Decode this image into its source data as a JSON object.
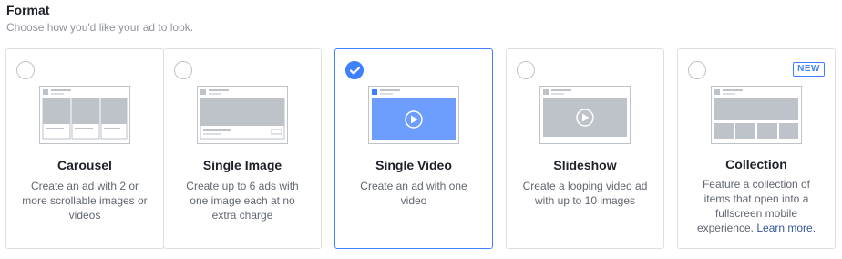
{
  "header": {
    "title": "Format",
    "subtitle": "Choose how you'd like your ad to look."
  },
  "cards": [
    {
      "title": "Carousel",
      "description": "Create an ad with 2 or more scrollable images or videos",
      "selected": false
    },
    {
      "title": "Single Image",
      "description": "Create up to 6 ads with one image each at no extra charge",
      "selected": false
    },
    {
      "title": "Single Video",
      "description": "Create an ad with one video",
      "selected": true
    },
    {
      "title": "Slideshow",
      "description": "Create a looping video ad with up to 10 images",
      "selected": false
    },
    {
      "title": "Collection",
      "description": "Feature a collection of items that open into a fullscreen mobile experience.",
      "link": "Learn more.",
      "badge": "NEW",
      "selected": false
    }
  ],
  "colors": {
    "accent": "#4080ff",
    "border": "#dddfe2",
    "thumb_gray": "#bec2c9"
  }
}
